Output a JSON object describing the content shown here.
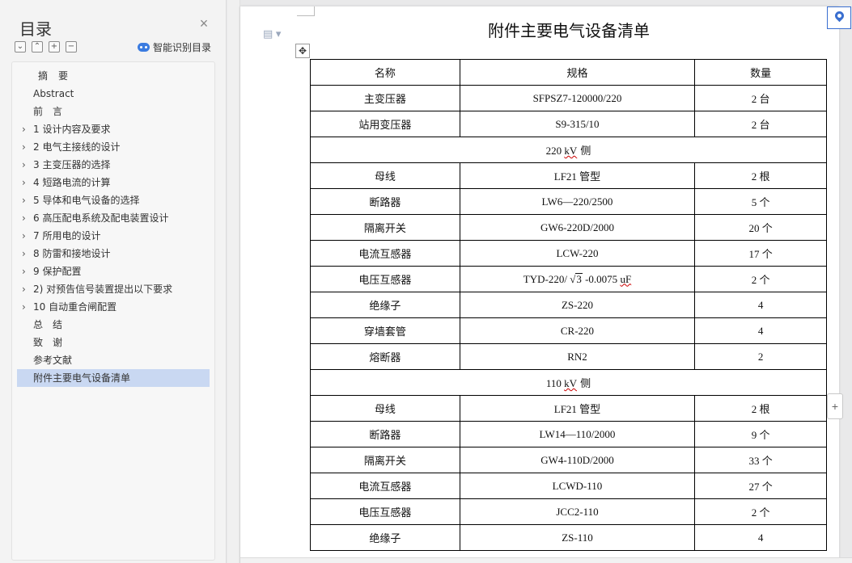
{
  "sidebar": {
    "title": "目录",
    "close_icon": "×",
    "tools": [
      "⌄",
      "⌃",
      "+",
      "−"
    ],
    "smart_label": "智能识别目录",
    "items": [
      {
        "label": "摘　要",
        "arrow": false,
        "top": true
      },
      {
        "label": "Abstract",
        "arrow": false,
        "top": false
      },
      {
        "label": "前　言",
        "arrow": false,
        "top": false
      },
      {
        "label": "1  设计内容及要求",
        "arrow": true
      },
      {
        "label": "2  电气主接线的设计",
        "arrow": true
      },
      {
        "label": "3  主变压器的选择",
        "arrow": true
      },
      {
        "label": "4  短路电流的计算",
        "arrow": true
      },
      {
        "label": "5  导体和电气设备的选择",
        "arrow": true
      },
      {
        "label": "6  高压配电系统及配电装置设计",
        "arrow": true
      },
      {
        "label": "7  所用电的设计",
        "arrow": true
      },
      {
        "label": "8  防雷和接地设计",
        "arrow": true
      },
      {
        "label": "9  保护配置",
        "arrow": true
      },
      {
        "label": "2)  对预告信号装置提出以下要求",
        "arrow": true
      },
      {
        "label": "10  自动重合闸配置",
        "arrow": true
      },
      {
        "label": "总　结",
        "arrow": false
      },
      {
        "label": "致　谢",
        "arrow": false
      },
      {
        "label": "参考文献",
        "arrow": false
      },
      {
        "label": "附件主要电气设备清单",
        "arrow": false,
        "selected": true
      }
    ]
  },
  "document": {
    "title": "附件主要电气设备清单",
    "table": {
      "headers": [
        "名称",
        "规格",
        "数量"
      ],
      "rows": [
        {
          "name": "主变压器",
          "spec": "SFPSZ7-120000/220",
          "qty": "2 台"
        },
        {
          "name": "站用变压器",
          "spec": "S9-315/10",
          "qty": "2 台"
        },
        {
          "section": "220 kV 侧"
        },
        {
          "name": "母线",
          "spec": "LF21 管型",
          "qty": "2 根"
        },
        {
          "name": "断路器",
          "spec": "LW6—220/2500",
          "qty": "5 个"
        },
        {
          "name": "隔离开关",
          "spec": "GW6-220D/2000",
          "qty": "20 个"
        },
        {
          "name": "电流互感器",
          "spec": "LCW-220",
          "qty": "17 个"
        },
        {
          "name": "电压互感器",
          "spec_prefix": "TYD-220/ ",
          "spec_sqrt": "3",
          "spec_suffix": " -0.0075 ",
          "spec_unit": "uF",
          "qty": "2 个"
        },
        {
          "name": "绝缘子",
          "spec": "ZS-220",
          "qty": "4"
        },
        {
          "name": "穿墙套管",
          "spec": "CR-220",
          "qty": "4"
        },
        {
          "name": "熔断器",
          "spec": "RN2",
          "qty": "2"
        },
        {
          "section": "110 kV 侧"
        },
        {
          "name": "母线",
          "spec": "LF21 管型",
          "qty": "2 根"
        },
        {
          "name": "断路器",
          "spec": "LW14—110/2000",
          "qty": "9 个"
        },
        {
          "name": "隔离开关",
          "spec": "GW4-110D/2000",
          "qty": "33 个"
        },
        {
          "name": "电流互感器",
          "spec": "LCWD-110",
          "qty": "27 个"
        },
        {
          "name": "电压互感器",
          "spec": "JCC2-110",
          "qty": "2 个"
        },
        {
          "name": "绝缘子",
          "spec": "ZS-110",
          "qty": "4"
        }
      ]
    }
  },
  "colors": {
    "selected": "#c9d8f2",
    "accent": "#3a6fd0"
  },
  "icons": {
    "doc": "document-icon",
    "move": "move-handle-icon",
    "location": "location-pin-icon",
    "add": "add-column-icon"
  }
}
